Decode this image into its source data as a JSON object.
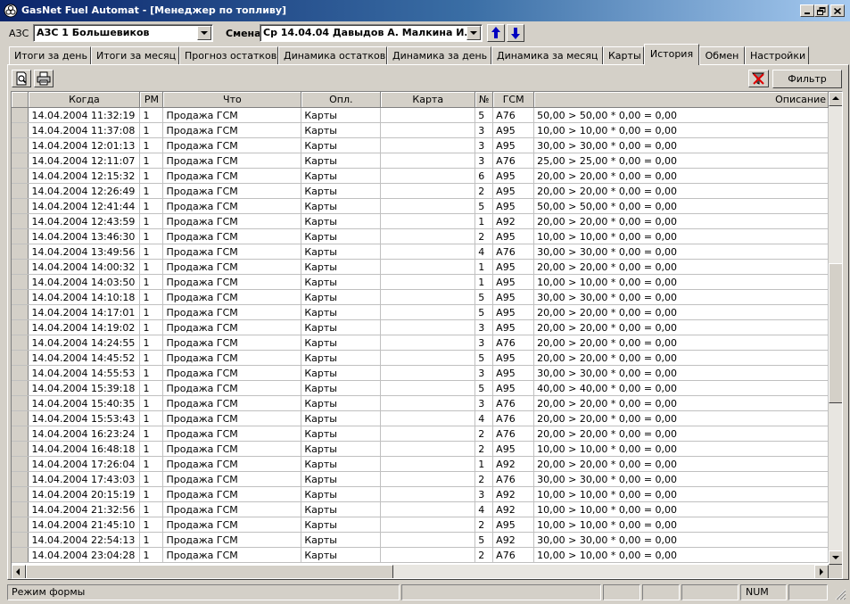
{
  "window": {
    "title": "GasNet Fuel Automat - [Менеджер по топливу]",
    "app_icon": "gasnet-logo-icon"
  },
  "toolbar": {
    "azs_label": "АЗС",
    "azs_value": "АЗС 1 Большевиков",
    "shift_label": "Смена",
    "shift_value": "Ср 14.04.04 Давыдов А. Малкина И."
  },
  "tabs": [
    {
      "label": "Итоги за день"
    },
    {
      "label": "Итоги за месяц"
    },
    {
      "label": "Прогноз остатков"
    },
    {
      "label": "Динамика остатков"
    },
    {
      "label": "Динамика за день"
    },
    {
      "label": "Динамика за месяц"
    },
    {
      "label": "Карты"
    },
    {
      "label": "История",
      "active": true
    },
    {
      "label": "Обмен"
    },
    {
      "label": "Настройки"
    }
  ],
  "actions": {
    "preview_icon": "print-preview-icon",
    "print_icon": "printer-icon",
    "clear_filter_icon": "clear-filter-icon",
    "filter_label": "Фильтр"
  },
  "grid": {
    "columns": [
      "Когда",
      "РМ",
      "Что",
      "Опл.",
      "Карта",
      "№",
      "ГСМ",
      "Описание"
    ],
    "rows": [
      [
        "14.04.2004 11:32:19",
        "1",
        "Продажа ГСМ",
        "Карты",
        "",
        "5",
        "А76",
        "50,00 > 50,00 * 0,00 = 0,00"
      ],
      [
        "14.04.2004 11:37:08",
        "1",
        "Продажа ГСМ",
        "Карты",
        "",
        "3",
        "А95",
        "10,00 > 10,00 * 0,00 = 0,00"
      ],
      [
        "14.04.2004 12:01:13",
        "1",
        "Продажа ГСМ",
        "Карты",
        "",
        "3",
        "А95",
        "30,00 > 30,00 * 0,00 = 0,00"
      ],
      [
        "14.04.2004 12:11:07",
        "1",
        "Продажа ГСМ",
        "Карты",
        "",
        "3",
        "А76",
        "25,00 > 25,00 * 0,00 = 0,00"
      ],
      [
        "14.04.2004 12:15:32",
        "1",
        "Продажа ГСМ",
        "Карты",
        "",
        "6",
        "А95",
        "20,00 > 20,00 * 0,00 = 0,00"
      ],
      [
        "14.04.2004 12:26:49",
        "1",
        "Продажа ГСМ",
        "Карты",
        "",
        "2",
        "А95",
        "20,00 > 20,00 * 0,00 = 0,00"
      ],
      [
        "14.04.2004 12:41:44",
        "1",
        "Продажа ГСМ",
        "Карты",
        "",
        "5",
        "А95",
        "50,00 > 50,00 * 0,00 = 0,00"
      ],
      [
        "14.04.2004 12:43:59",
        "1",
        "Продажа ГСМ",
        "Карты",
        "",
        "1",
        "А92",
        "20,00 > 20,00 * 0,00 = 0,00"
      ],
      [
        "14.04.2004 13:46:30",
        "1",
        "Продажа ГСМ",
        "Карты",
        "",
        "2",
        "А95",
        "10,00 > 10,00 * 0,00 = 0,00"
      ],
      [
        "14.04.2004 13:49:56",
        "1",
        "Продажа ГСМ",
        "Карты",
        "",
        "4",
        "А76",
        "30,00 > 30,00 * 0,00 = 0,00"
      ],
      [
        "14.04.2004 14:00:32",
        "1",
        "Продажа ГСМ",
        "Карты",
        "",
        "1",
        "А95",
        "20,00 > 20,00 * 0,00 = 0,00"
      ],
      [
        "14.04.2004 14:03:50",
        "1",
        "Продажа ГСМ",
        "Карты",
        "",
        "1",
        "А95",
        "10,00 > 10,00 * 0,00 = 0,00"
      ],
      [
        "14.04.2004 14:10:18",
        "1",
        "Продажа ГСМ",
        "Карты",
        "",
        "5",
        "А95",
        "30,00 > 30,00 * 0,00 = 0,00"
      ],
      [
        "14.04.2004 14:17:01",
        "1",
        "Продажа ГСМ",
        "Карты",
        "",
        "5",
        "А95",
        "20,00 > 20,00 * 0,00 = 0,00"
      ],
      [
        "14.04.2004 14:19:02",
        "1",
        "Продажа ГСМ",
        "Карты",
        "",
        "3",
        "А95",
        "20,00 > 20,00 * 0,00 = 0,00"
      ],
      [
        "14.04.2004 14:24:55",
        "1",
        "Продажа ГСМ",
        "Карты",
        "",
        "3",
        "А76",
        "20,00 > 20,00 * 0,00 = 0,00"
      ],
      [
        "14.04.2004 14:45:52",
        "1",
        "Продажа ГСМ",
        "Карты",
        "",
        "5",
        "А95",
        "20,00 > 20,00 * 0,00 = 0,00"
      ],
      [
        "14.04.2004 14:55:53",
        "1",
        "Продажа ГСМ",
        "Карты",
        "",
        "3",
        "А95",
        "30,00 > 30,00 * 0,00 = 0,00"
      ],
      [
        "14.04.2004 15:39:18",
        "1",
        "Продажа ГСМ",
        "Карты",
        "",
        "5",
        "А95",
        "40,00 > 40,00 * 0,00 = 0,00"
      ],
      [
        "14.04.2004 15:40:35",
        "1",
        "Продажа ГСМ",
        "Карты",
        "",
        "3",
        "А76",
        "20,00 > 20,00 * 0,00 = 0,00"
      ],
      [
        "14.04.2004 15:53:43",
        "1",
        "Продажа ГСМ",
        "Карты",
        "",
        "4",
        "А76",
        "20,00 > 20,00 * 0,00 = 0,00"
      ],
      [
        "14.04.2004 16:23:24",
        "1",
        "Продажа ГСМ",
        "Карты",
        "",
        "2",
        "А76",
        "20,00 > 20,00 * 0,00 = 0,00"
      ],
      [
        "14.04.2004 16:48:18",
        "1",
        "Продажа ГСМ",
        "Карты",
        "",
        "2",
        "А95",
        "10,00 > 10,00 * 0,00 = 0,00"
      ],
      [
        "14.04.2004 17:26:04",
        "1",
        "Продажа ГСМ",
        "Карты",
        "",
        "1",
        "А92",
        "20,00 > 20,00 * 0,00 = 0,00"
      ],
      [
        "14.04.2004 17:43:03",
        "1",
        "Продажа ГСМ",
        "Карты",
        "",
        "2",
        "А76",
        "30,00 > 30,00 * 0,00 = 0,00"
      ],
      [
        "14.04.2004 20:15:19",
        "1",
        "Продажа ГСМ",
        "Карты",
        "",
        "3",
        "А92",
        "10,00 > 10,00 * 0,00 = 0,00"
      ],
      [
        "14.04.2004 21:32:56",
        "1",
        "Продажа ГСМ",
        "Карты",
        "",
        "4",
        "А92",
        "10,00 > 10,00 * 0,00 = 0,00"
      ],
      [
        "14.04.2004 21:45:10",
        "1",
        "Продажа ГСМ",
        "Карты",
        "",
        "2",
        "А95",
        "10,00 > 10,00 * 0,00 = 0,00"
      ],
      [
        "14.04.2004 22:54:13",
        "1",
        "Продажа ГСМ",
        "Карты",
        "",
        "5",
        "А92",
        "30,00 > 30,00 * 0,00 = 0,00"
      ],
      [
        "14.04.2004 23:04:28",
        "1",
        "Продажа ГСМ",
        "Карты",
        "",
        "2",
        "А76",
        "10,00 > 10,00 * 0,00 = 0,00"
      ]
    ]
  },
  "status": {
    "mode": "Режим формы",
    "num": "NUM"
  },
  "colors": {
    "titlebar_start": "#0a246a",
    "titlebar_end": "#a6caf0",
    "face": "#d4d0c8",
    "arrow_blue": "#0000c0"
  }
}
